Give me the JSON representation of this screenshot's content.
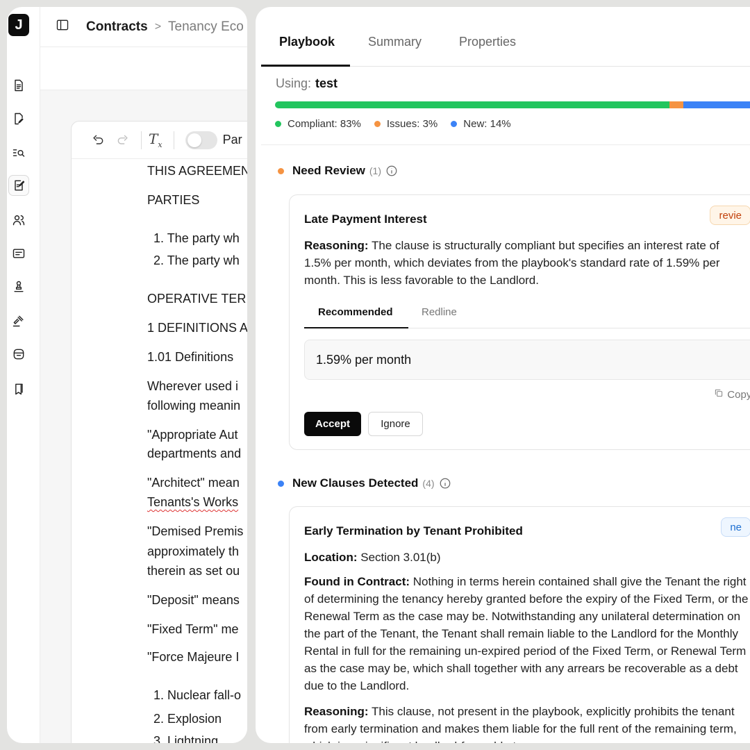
{
  "app": {
    "logo_letter": "J"
  },
  "breadcrumb": {
    "root": "Contracts",
    "separator": ">",
    "current": "Tenancy Eco"
  },
  "editor": {
    "toggle_label": "Par",
    "lines": [
      "THIS AGREEMENT",
      "PARTIES",
      "1. The party wh",
      "2. The party wh",
      "OPERATIVE TER",
      "1 DEFINITIONS A",
      "1.01 Definitions",
      "Wherever used i",
      "following meanin",
      "\"Appropriate Aut",
      "departments and",
      "\"Architect\" mean",
      "Tenants's Works",
      "\"Demised Premis",
      "approximately th",
      "therein as set ou",
      "\"Deposit\" means",
      "\"Fixed Term\" me",
      "\"Force Majeure I",
      "1. Nuclear fall-o",
      "2. Explosion",
      "3. Lightning"
    ]
  },
  "panel": {
    "tabs": [
      "Playbook",
      "Summary",
      "Properties"
    ],
    "using_label": "Using:",
    "using_value": "test",
    "progress": {
      "compliant": 83,
      "issues": 3,
      "new": 14
    },
    "legend": {
      "compliant": "Compliant: 83%",
      "issues": "Issues: 3%",
      "new": "New: 14%"
    },
    "colors": {
      "compliant": "#22c55e",
      "issues": "#f59342",
      "new": "#3b82f6"
    },
    "need_review": {
      "title": "Need Review",
      "count": "(1)",
      "card": {
        "title": "Late Payment Interest",
        "badge": "revie",
        "reasoning_label": "Reasoning:",
        "reasoning_text": "The clause is structurally compliant but specifies an interest rate of 1.5% per month, which deviates from the playbook's standard rate of 1.59% per month. This is less favorable to the Landlord.",
        "subtabs": [
          "Recommended",
          "Redline"
        ],
        "recommended_text": "1.59% per month",
        "copy_label": "Copy te",
        "accept_label": "Accept",
        "ignore_label": "Ignore"
      }
    },
    "new_clauses": {
      "title": "New Clauses Detected",
      "count": "(4)",
      "card": {
        "title": "Early Termination by Tenant Prohibited",
        "badge": "ne",
        "location_label": "Location:",
        "location_text": "Section 3.01(b)",
        "found_label": "Found in Contract:",
        "found_text": "Nothing in terms herein contained shall give the Tenant the right of determining the tenancy hereby granted before the expiry of the Fixed Term, or the Renewal Term as the case may be. Notwithstanding any unilateral determination on the part of the Tenant, the Tenant shall remain liable to the Landlord for the Monthly Rental in full for the remaining un-expired period of the Fixed Term, or Renewal Term as the case may be, which shall together with any arrears be recoverable as a debt due to the Landlord.",
        "reasoning_label": "Reasoning:",
        "reasoning_text": "This clause, not present in the playbook, explicitly prohibits the tenant from early termination and makes them liable for the full rent of the remaining term, which is a significant landlord-favorable term."
      }
    }
  }
}
